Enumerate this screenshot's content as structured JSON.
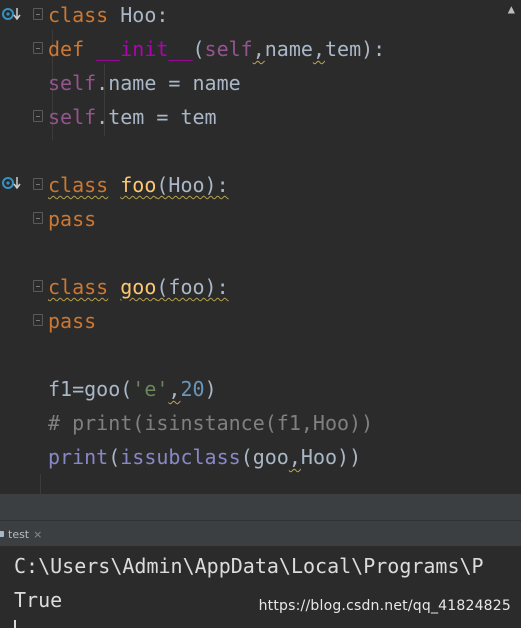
{
  "editor": {
    "lines": [
      {
        "id": "l1",
        "parts": [
          [
            "kw",
            "class"
          ],
          [
            "txt",
            " Hoo:"
          ]
        ]
      },
      {
        "id": "l2",
        "parts": [
          [
            "kw",
            "def"
          ],
          [
            "txt",
            " "
          ],
          [
            "magic",
            "__init__"
          ],
          [
            "txt",
            "("
          ],
          [
            "self",
            "self"
          ],
          [
            "txtw",
            ","
          ],
          [
            "txt",
            "name"
          ],
          [
            "txtw",
            ","
          ],
          [
            "txt",
            "tem):"
          ]
        ]
      },
      {
        "id": "l3",
        "parts": [
          [
            "self",
            "self"
          ],
          [
            "txt",
            ".name = name"
          ]
        ]
      },
      {
        "id": "l4",
        "parts": [
          [
            "self",
            "self"
          ],
          [
            "txt",
            ".tem = tem"
          ]
        ]
      },
      {
        "id": "l5",
        "parts": [
          [
            "kwsq",
            "class"
          ],
          [
            "txt",
            " "
          ],
          [
            "fnsq",
            "foo"
          ],
          [
            "txtsq",
            "(Hoo):"
          ]
        ]
      },
      {
        "id": "l6",
        "parts": [
          [
            "kw",
            "pass"
          ]
        ]
      },
      {
        "id": "l7",
        "parts": [
          [
            "kwsq",
            "class"
          ],
          [
            "txt",
            " "
          ],
          [
            "fnsq",
            "goo"
          ],
          [
            "txtsq",
            "(foo):"
          ]
        ]
      },
      {
        "id": "l8",
        "parts": [
          [
            "kw",
            "pass"
          ]
        ]
      },
      {
        "id": "l9",
        "parts": [
          [
            "txt",
            "f1=goo("
          ],
          [
            "str",
            "'e'"
          ],
          [
            "txtw",
            ","
          ],
          [
            "num",
            "20"
          ],
          [
            "txt",
            ")"
          ]
        ]
      },
      {
        "id": "l10",
        "parts": [
          [
            "cmt",
            "# print(isinstance(f1,Hoo))"
          ]
        ]
      },
      {
        "id": "l11",
        "parts": [
          [
            "bi",
            "print"
          ],
          [
            "txt",
            "("
          ],
          [
            "bi",
            "issubclass"
          ],
          [
            "txt",
            "(goo"
          ],
          [
            "txtw",
            ","
          ],
          [
            "txt",
            "Hoo))"
          ]
        ]
      }
    ]
  },
  "run_panel": {
    "tab_label": "test",
    "tab_close": "×",
    "output": [
      "C:\\Users\\Admin\\AppData\\Local\\Programs\\P",
      "True"
    ]
  },
  "watermark": "https://blog.csdn.net/qq_41824825",
  "warning_icon": "▲",
  "colors": {
    "background": "#2b2b2b",
    "keyword": "#cc7832",
    "magic_method": "#b200b2",
    "self": "#94558d",
    "string": "#6a8759",
    "number": "#6897bb",
    "comment": "#808080",
    "builtin": "#8888c6"
  }
}
